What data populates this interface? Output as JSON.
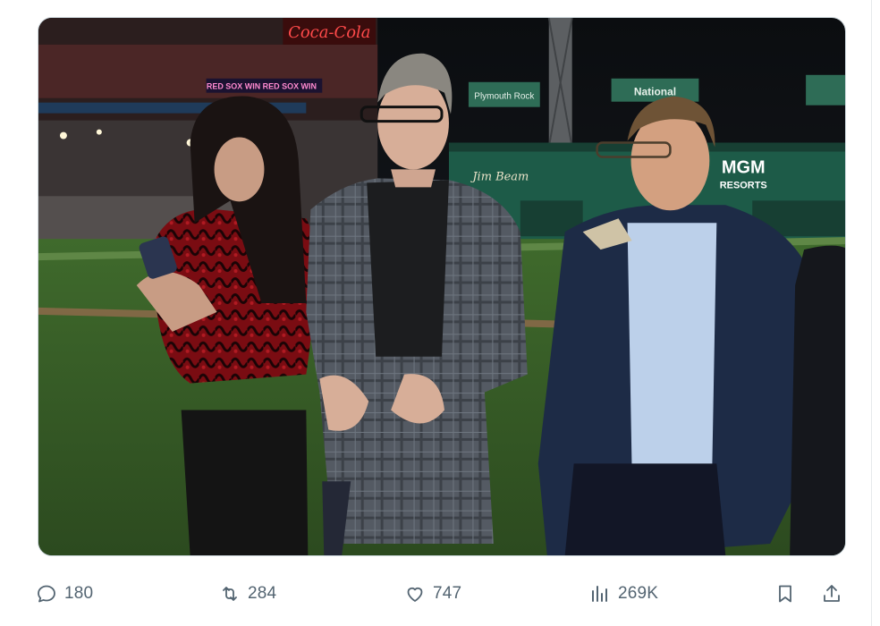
{
  "post": {
    "media": {
      "signs": {
        "cola": "Coca-Cola",
        "red_sox_win": "RED SOX WIN  RED SOX WIN",
        "mgm_line1": "MGM",
        "mgm_line2": "RESORTS",
        "jim_beam": "Jim Beam",
        "national": "National",
        "plymouth": "Plymouth Rock"
      }
    },
    "actions": {
      "reply_count": "180",
      "repost_count": "284",
      "like_count": "747",
      "view_count": "269K"
    },
    "icons": {
      "reply": "reply-icon",
      "repost": "repost-icon",
      "like": "heart-icon",
      "views": "views-icon",
      "bookmark": "bookmark-icon",
      "share": "share-icon"
    },
    "colors": {
      "action_gray": "#536471",
      "border": "#cfd9de"
    }
  }
}
